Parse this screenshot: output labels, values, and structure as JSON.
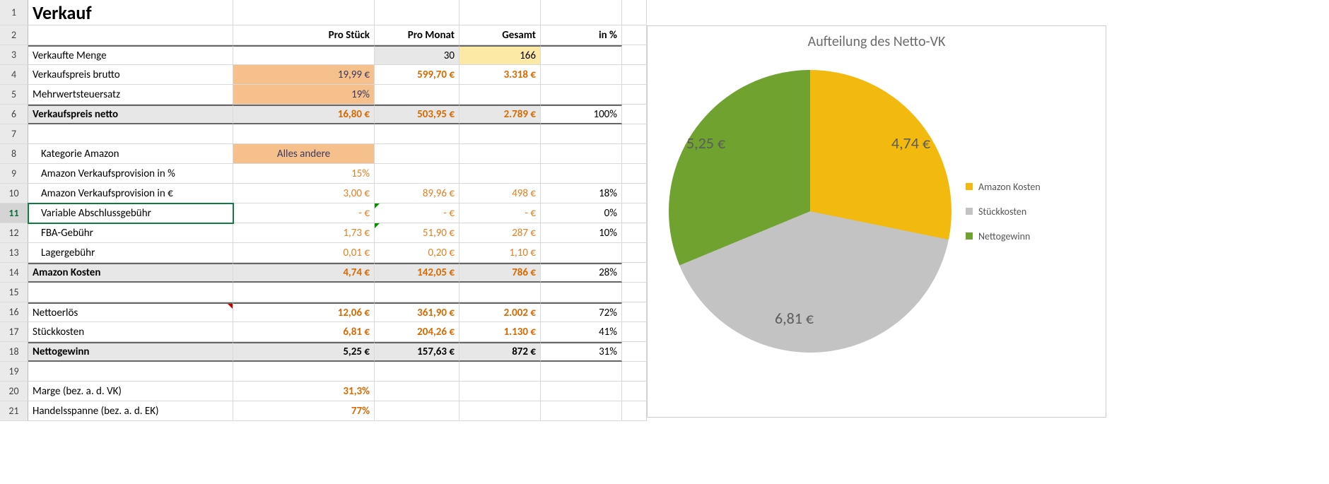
{
  "title": "Verkauf",
  "columns": {
    "c": "Pro Stück",
    "d": "Pro Monat",
    "e": "Gesamt",
    "f": "in %"
  },
  "rows": {
    "r3": {
      "b": "Verkaufte Menge",
      "d": "30",
      "e": "166"
    },
    "r4": {
      "b": "Verkaufspreis brutto",
      "c": "19,99 €",
      "d": "599,70 €",
      "e": "3.318 €"
    },
    "r5": {
      "b": "Mehrwertsteuersatz",
      "c": "19%"
    },
    "r6": {
      "b": "Verkaufspreis netto",
      "c": "16,80 €",
      "d": "503,95 €",
      "e": "2.789 €",
      "f": "100%"
    },
    "r8": {
      "b": "Kategorie Amazon",
      "c": "Alles andere"
    },
    "r9": {
      "b": "Amazon Verkaufsprovision in %",
      "c": "15%"
    },
    "r10": {
      "b": "Amazon Verkaufsprovision in €",
      "c": "3,00 €",
      "d": "89,96 €",
      "e": "498 €",
      "f": "18%"
    },
    "r11": {
      "b": "Variable Abschlussgebühr",
      "c": "-     €",
      "d": "-     €",
      "e": "-     €",
      "f": "0%"
    },
    "r12": {
      "b": "FBA-Gebühr",
      "c": "1,73 €",
      "d": "51,90 €",
      "e": "287 €",
      "f": "10%"
    },
    "r13": {
      "b": "Lagergebühr",
      "c": "0,01 €",
      "d": "0,20 €",
      "e": "1,10 €"
    },
    "r14": {
      "b": "Amazon Kosten",
      "c": "4,74 €",
      "d": "142,05 €",
      "e": "786 €",
      "f": "28%"
    },
    "r16": {
      "b": "Nettoerlös",
      "c": "12,06 €",
      "d": "361,90 €",
      "e": "2.002 €",
      "f": "72%"
    },
    "r17": {
      "b": "Stückkosten",
      "c": "6,81 €",
      "d": "204,26 €",
      "e": "1.130 €",
      "f": "41%"
    },
    "r18": {
      "b": "Nettogewinn",
      "c": "5,25 €",
      "d": "157,63 €",
      "e": "872 €",
      "f": "31%"
    },
    "r20": {
      "b": "Marge (bez. a. d. VK)",
      "c": "31,3%"
    },
    "r21": {
      "b": "Handelsspanne (bez. a. d. EK)",
      "c": "77%"
    }
  },
  "chart": {
    "title": "Aufteilung des Netto-VK",
    "labels": {
      "amazon": "4,74 €",
      "stueck": "6,81 €",
      "netto": "5,25 €"
    },
    "legend": {
      "amazon": "Amazon Kosten",
      "stueck": "Stückkosten",
      "netto": "Nettogewinn"
    },
    "colors": {
      "amazon": "#f2b90f",
      "stueck": "#c3c3c3",
      "netto": "#6fa22f"
    }
  },
  "chart_data": {
    "type": "pie",
    "title": "Aufteilung des Netto-VK",
    "categories": [
      "Amazon Kosten",
      "Stückkosten",
      "Nettogewinn"
    ],
    "values": [
      4.74,
      6.81,
      5.25
    ],
    "unit": "€",
    "colors": [
      "#f2b90f",
      "#c3c3c3",
      "#6fa22f"
    ]
  }
}
